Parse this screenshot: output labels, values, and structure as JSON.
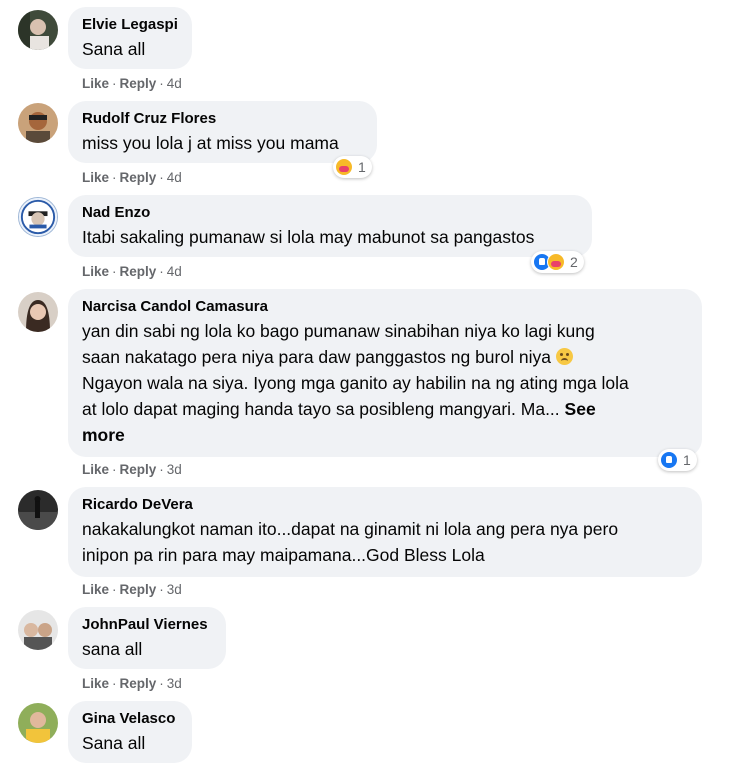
{
  "actions": {
    "like": "Like",
    "reply": "Reply",
    "separator": "·"
  },
  "comments": [
    {
      "name": "Elvie Legaspi",
      "text": "Sana all",
      "time": "4d",
      "avatar_icon": "profile-photo"
    },
    {
      "name": "Rudolf Cruz Flores",
      "text": "miss you lola j at miss you mama",
      "time": "4d",
      "reaction_count": "1",
      "reaction_icons": [
        "care-icon"
      ],
      "avatar_icon": "profile-photo"
    },
    {
      "name": "Nad Enzo",
      "text": "Itabi sakaling pumanaw si lola may mabunot sa pangastos",
      "time": "4d",
      "reaction_count": "2",
      "reaction_icons": [
        "like-icon",
        "care-icon"
      ],
      "avatar_icon": "profile-photo"
    },
    {
      "name": "Narcisa Candol Camasura",
      "text_lines": [
        "yan din sabi ng lola ko bago pumanaw sinabihan niya ko lagi kung",
        "saan nakatago pera niya para daw panggastos ng burol niya",
        "Ngayon wala na siya. Iyong mga ganito ay habilin na ng ating mga lola",
        "at lolo dapat maging handa tayo sa posibleng mangyari. Ma..."
      ],
      "see_more": "See more",
      "see_more_a": "See",
      "see_more_b": "more",
      "time": "3d",
      "reaction_count": "1",
      "reaction_icons": [
        "like-icon"
      ],
      "emoji": "sad-face-emoji",
      "avatar_icon": "profile-photo"
    },
    {
      "name": "Ricardo DeVera",
      "text_lines": [
        "nakakalungkot naman ito...dapat na ginamit ni lola ang pera nya pero",
        "inipon pa rin para may maipamana...God Bless Lola"
      ],
      "time": "3d",
      "avatar_icon": "profile-photo"
    },
    {
      "name": "JohnPaul Viernes",
      "text": "sana all",
      "time": "3d",
      "avatar_icon": "profile-photo"
    },
    {
      "name": "Gina Velasco",
      "text": "Sana all",
      "avatar_icon": "profile-photo"
    }
  ],
  "colors": {
    "bubble": "#f0f2f5",
    "meta": "#65676b",
    "like_blue": "#1877f2",
    "care_yellow": "#f7b928"
  }
}
